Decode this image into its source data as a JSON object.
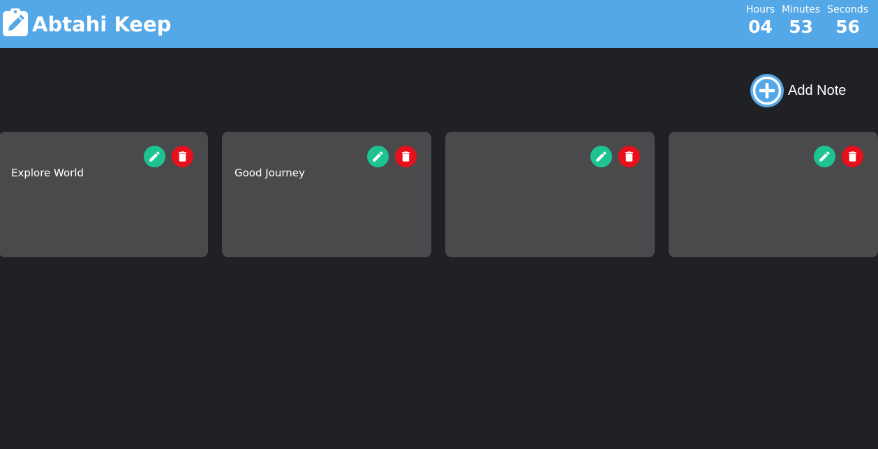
{
  "header": {
    "title": "Abtahi Keep",
    "logo_icon": "clipboard-edit-icon",
    "background_color": "#54a8e8"
  },
  "timer": {
    "units": [
      {
        "label": "Hours",
        "value": "04"
      },
      {
        "label": "Minutes",
        "value": "53"
      },
      {
        "label": "Seconds",
        "value": "56"
      }
    ]
  },
  "add_note": {
    "label": "Add Note",
    "icon": "plus-circle-icon"
  },
  "notes": [
    {
      "text": "Explore World"
    },
    {
      "text": "Good Journey"
    },
    {
      "text": ""
    },
    {
      "text": ""
    }
  ],
  "note_actions": {
    "edit_icon": "pencil-icon",
    "delete_icon": "trash-icon",
    "edit_color": "#1dc492",
    "delete_color": "#e8101a"
  },
  "colors": {
    "page_background": "#202125",
    "note_background": "#4a4a4c"
  }
}
